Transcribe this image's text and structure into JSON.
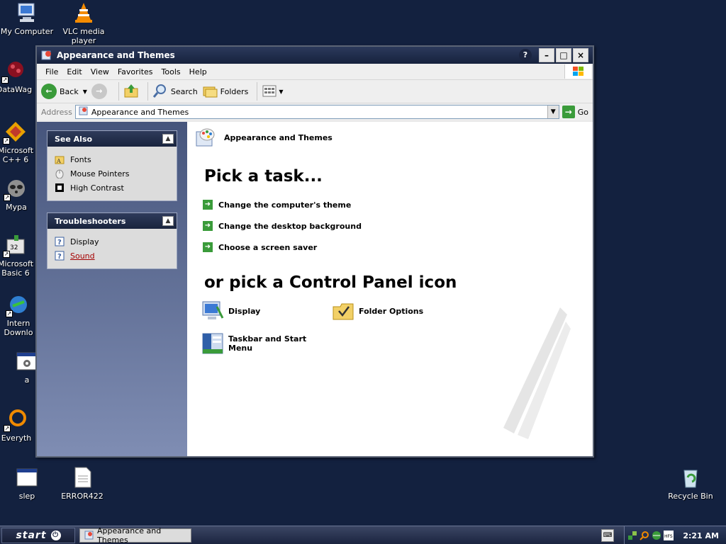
{
  "desktop": {
    "icons": [
      {
        "label": "My Computer"
      },
      {
        "label": "VLC media player"
      },
      {
        "label": "DataWag"
      },
      {
        "label": "Microsoft C++ 6"
      },
      {
        "label": "Mypa"
      },
      {
        "label": "Microsoft Basic 6"
      },
      {
        "label": "Intern Downlo"
      },
      {
        "label": "a"
      },
      {
        "label": "Everyth"
      },
      {
        "label": "slep"
      },
      {
        "label": "ERROR422"
      },
      {
        "label": "Recycle Bin"
      }
    ]
  },
  "window": {
    "title": "Appearance and Themes",
    "buttons": {
      "help": "?",
      "minimize": "–",
      "maximize": "□",
      "close": "×"
    },
    "menu": [
      "File",
      "Edit",
      "View",
      "Favorites",
      "Tools",
      "Help"
    ],
    "toolbar": {
      "back": "Back",
      "search": "Search",
      "folders": "Folders"
    },
    "address": {
      "label": "Address",
      "value": "Appearance and Themes",
      "go": "Go"
    }
  },
  "sidebar": {
    "see_also": {
      "title": "See Also",
      "items": [
        {
          "label": "Fonts"
        },
        {
          "label": "Mouse Pointers"
        },
        {
          "label": "High Contrast"
        }
      ]
    },
    "troubleshooters": {
      "title": "Troubleshooters",
      "items": [
        {
          "label": "Display"
        },
        {
          "label": "Sound"
        }
      ]
    }
  },
  "main": {
    "header": "Appearance and Themes",
    "pick_task": "Pick a task...",
    "tasks": [
      "Change the computer's theme",
      "Change the desktop background",
      "Choose a screen saver"
    ],
    "pick_icon": "or pick a Control Panel icon",
    "icons": [
      {
        "label": "Display"
      },
      {
        "label": "Folder Options"
      },
      {
        "label": "Taskbar and Start Menu"
      }
    ]
  },
  "taskbar": {
    "start": "start",
    "task_button": "Appearance and Themes",
    "clock": "2:21 AM"
  },
  "colors": {
    "desktop": "#13213f",
    "titlebar": "#16223d",
    "task_arrow": "#3a9b3a",
    "link": "#a50000"
  }
}
